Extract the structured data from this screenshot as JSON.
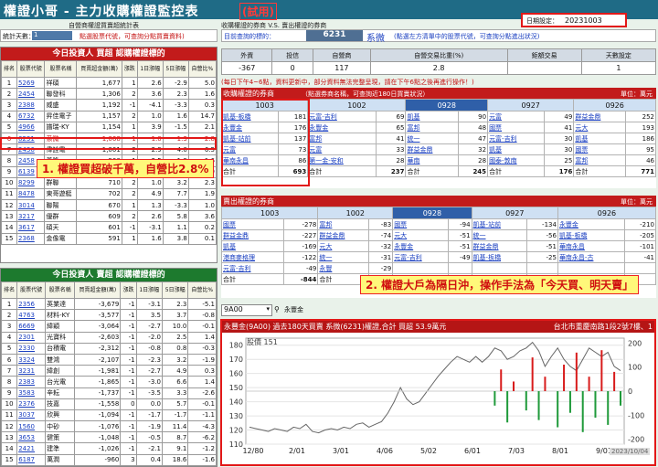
{
  "title_bar": {
    "title": "權證小哥 - 主力收購權證監控表",
    "badge": "(試用)"
  },
  "left_header": {
    "subtitle": "自營商權證買賣超統計表",
    "days_label": "統計天數：",
    "days_value": "1",
    "hint": "點選股票代號，可查詢分點買賣資料)"
  },
  "mid_header": {
    "subtitle": "收購權證的券商 V.S. 賣出權證的券商",
    "query_label": "目前查詢的標的：",
    "stock_code": "6231",
    "stock_name": "系微",
    "query_hint": "(點選左方清單中的股票代號，可查詢分點進出狀況)",
    "date_label": "日期設定：",
    "date_value": "20231003"
  },
  "summary": {
    "headers": [
      "外資",
      "投信",
      "自營商",
      "自營交易比重(%)",
      "鉅額交易",
      "天數設定"
    ],
    "values": [
      "-367",
      "0",
      "117",
      "2.8",
      "",
      "1"
    ]
  },
  "notice": "(每日下午4~6點，資料更新中，部分資料無法完整呈現，請在下午6點之後再進行操作！)",
  "buy_panel": {
    "title": "今日投資人 買超 認購權證標的",
    "columns": [
      "排名",
      "股票代號",
      "股票名稱",
      "買賣超金額(萬)",
      "漲跌",
      "1日漲幅",
      "5日漲幅",
      "自營比%"
    ],
    "rows": [
      [
        "1",
        "5269",
        "祥碩",
        "1,677",
        "1",
        "2.6",
        "-2.9",
        "5.0"
      ],
      [
        "2",
        "2454",
        "聯發科",
        "1,306",
        "2",
        "3.6",
        "2.3",
        "1.6"
      ],
      [
        "3",
        "2388",
        "威盛",
        "1,192",
        "-1",
        "-4.1",
        "-3.3",
        "0.3"
      ],
      [
        "4",
        "6732",
        "昇佳電子",
        "1,157",
        "2",
        "1.0",
        "1.6",
        "14.7"
      ],
      [
        "5",
        "4966",
        "譜瑞-KY",
        "1,154",
        "1",
        "3.9",
        "-1.5",
        "2.1"
      ],
      [
        "6",
        "6231",
        "系微",
        "1,068",
        "-1",
        "-1.0",
        "-1.3",
        "2.8"
      ],
      [
        "7",
        "2436",
        "偉詮電",
        "1,001",
        "2",
        "2.9",
        "4.0",
        "6.5"
      ],
      [
        "8",
        "2458",
        "義隆",
        "900",
        "1",
        "2.5",
        "1.9",
        "1.6"
      ],
      [
        "9",
        "6139",
        "亞翔",
        "755",
        "0",
        "0.0",
        "12.8",
        "0.9"
      ],
      [
        "10",
        "8299",
        "群聯",
        "710",
        "2",
        "1.0",
        "3.2",
        "2.3"
      ],
      [
        "11",
        "8478",
        "東哥遊艇",
        "702",
        "2",
        "4.9",
        "7.7",
        "1.9"
      ],
      [
        "12",
        "3014",
        "聯陽",
        "670",
        "1",
        "1.3",
        "-3.3",
        "1.0"
      ],
      [
        "13",
        "3217",
        "優群",
        "609",
        "2",
        "2.6",
        "5.8",
        "3.6"
      ],
      [
        "14",
        "3617",
        "碩天",
        "601",
        "-1",
        "-3.1",
        "1.1",
        "0.2"
      ],
      [
        "15",
        "2368",
        "金像電",
        "591",
        "1",
        "1.6",
        "3.8",
        "0.1"
      ]
    ]
  },
  "sell_panel": {
    "title": "今日投資人 賣超 認購權證標的",
    "columns": [
      "排名",
      "股票代號",
      "股票名稱",
      "買賣超金額(萬)",
      "漲跌",
      "1日漲幅",
      "5日漲幅",
      "自營比%"
    ],
    "rows": [
      [
        "1",
        "2356",
        "英業達",
        "-3,679",
        "-1",
        "-3.1",
        "2.3",
        "-5.1"
      ],
      [
        "2",
        "4763",
        "材料-KY",
        "-3,577",
        "-1",
        "3.5",
        "3.7",
        "-0.8"
      ],
      [
        "3",
        "6669",
        "緯穎",
        "-3,064",
        "-1",
        "-2.7",
        "10.0",
        "-0.1"
      ],
      [
        "4",
        "2301",
        "光寶科",
        "-2,603",
        "-1",
        "-2.0",
        "2.5",
        "1.4"
      ],
      [
        "5",
        "2330",
        "台積電",
        "-2,312",
        "-1",
        "-0.8",
        "0.8",
        "-0.3"
      ],
      [
        "6",
        "3324",
        "雙鴻",
        "-2,107",
        "-1",
        "-2.3",
        "3.2",
        "-1.9"
      ],
      [
        "7",
        "3231",
        "緯創",
        "-1,981",
        "-1",
        "-2.7",
        "4.9",
        "0.3"
      ],
      [
        "8",
        "2383",
        "台光電",
        "-1,865",
        "-1",
        "-3.0",
        "6.6",
        "1.4"
      ],
      [
        "9",
        "3583",
        "辛耘",
        "-1,737",
        "-1",
        "-3.5",
        "3.3",
        "-2.6"
      ],
      [
        "10",
        "2376",
        "技嘉",
        "-1,558",
        "0",
        "0.0",
        "5.7",
        "-0.1"
      ],
      [
        "11",
        "3037",
        "欣興",
        "-1,094",
        "-1",
        "-1.7",
        "-1.7",
        "-1.1"
      ],
      [
        "12",
        "1560",
        "中砂",
        "-1,076",
        "-1",
        "-1.9",
        "11.4",
        "-4.3"
      ],
      [
        "13",
        "3653",
        "健策",
        "-1,048",
        "-1",
        "-0.5",
        "8.7",
        "-6.2"
      ],
      [
        "14",
        "2421",
        "建準",
        "-1,026",
        "-1",
        "-2.1",
        "9.1",
        "-1.2"
      ],
      [
        "15",
        "6187",
        "萬潤",
        "-960",
        "3",
        "0.4",
        "18.6",
        "-1.6"
      ]
    ]
  },
  "buy_brokers": {
    "title": "收購權證的券商",
    "hint": "（點選券商名稱，可查詢近180日買賣狀況）",
    "unit": "單位：萬元",
    "dates": [
      "1003",
      "1002",
      "0928",
      "0927",
      "0926"
    ],
    "cols": [
      [
        [
          "凱基-板橋",
          "181"
        ],
        [
          "永豐金",
          "176"
        ],
        [
          "凱基-站前",
          "137"
        ],
        [
          "元富",
          "73"
        ],
        [
          "華南永昌",
          "86"
        ]
      ],
      [
        [
          "元富-吉利",
          "69"
        ],
        [
          "永豐金",
          "65"
        ],
        [
          "富邦",
          "41"
        ],
        [
          "元富",
          "33"
        ],
        [
          "第一金-安和",
          "28"
        ]
      ],
      [
        [
          "凱基",
          "90"
        ],
        [
          "富邦",
          "48"
        ],
        [
          "統一",
          "47"
        ],
        [
          "群益金鼎",
          "32"
        ],
        [
          "華南",
          "28"
        ]
      ],
      [
        [
          "元富",
          "49"
        ],
        [
          "國票",
          "41"
        ],
        [
          "元富-吉利",
          "30"
        ],
        [
          "凱基",
          "30"
        ],
        [
          "國泰-敦南",
          "25"
        ]
      ],
      [
        [
          "群益金鼎",
          "252"
        ],
        [
          "元大",
          "193"
        ],
        [
          "凱基",
          "186"
        ],
        [
          "國票",
          "95"
        ],
        [
          "富邦",
          "46"
        ]
      ]
    ],
    "totals": [
      "693",
      "237",
      "245",
      "176",
      "771"
    ],
    "total_label": "合計"
  },
  "sell_brokers": {
    "title": "賣出權證的券商",
    "unit": "單位：萬元",
    "dates": [
      "1003",
      "1002",
      "0928",
      "0927",
      "0926"
    ],
    "cols": [
      [
        [
          "國票",
          "-278"
        ],
        [
          "群益金鼎",
          "-227"
        ],
        [
          "凱基",
          "-169"
        ],
        [
          "港商麥格理",
          "-122"
        ],
        [
          "元富-吉利",
          "-49"
        ]
      ],
      [
        [
          "富邦",
          "-83"
        ],
        [
          "群益金鼎",
          "-74"
        ],
        [
          "元大",
          "-32"
        ],
        [
          "統一",
          "-31"
        ],
        [
          "永豐",
          "-29"
        ]
      ],
      [
        [
          "國票",
          "-94"
        ],
        [
          "元大",
          "-51"
        ],
        [
          "永豐金",
          "-51"
        ],
        [
          "元富-吉利",
          "-49"
        ],
        [
          "",
          ""
        ]
      ],
      [
        [
          "凱基-站前",
          "-134"
        ],
        [
          "統一",
          "-56"
        ],
        [
          "群益金鼎",
          "-51"
        ],
        [
          "凱基-板橋",
          "-25"
        ],
        [
          "",
          ""
        ]
      ],
      [
        [
          "永豐金",
          "-210"
        ],
        [
          "凱基-板橋",
          "-205"
        ],
        [
          "華南永昌",
          "-101"
        ],
        [
          "華南永昌-古",
          "-41"
        ],
        [
          "",
          ""
        ]
      ]
    ],
    "totals": [
      "-844",
      "",
      "",
      "",
      ""
    ],
    "total_label": "合計"
  },
  "callouts": {
    "c1": "1. 權證買超破千萬，自營比2.8%",
    "c2": "2. 權證大戶為隔日沖，操作手法為「今天買、明天賣」"
  },
  "broker_selector": {
    "value": "9A00",
    "name": "永豐金"
  },
  "chart": {
    "title": "永豐金(9A00) 過去180天買賣 系微(6231)權證,合計  買超 53.9萬元",
    "address": "台北市重慶南路1段2號7樓、1",
    "price_label": "股價 151",
    "date_badge": "2023/10/04"
  },
  "chart_data": {
    "type": "line",
    "title": "永豐金(9A00) 過去180天買賣 系微(6231)權證,合計  買超 53.9萬元",
    "x_ticks": [
      "12/80",
      "2/01",
      "3/01",
      "4/06",
      "5/02",
      "6/01",
      "7/03",
      "8/01",
      "9/01"
    ],
    "y_left": {
      "ticks": [
        "180",
        "170",
        "160",
        "150",
        "140",
        "130",
        "120",
        "110"
      ],
      "ylim": [
        110,
        185
      ]
    },
    "y_right": {
      "ticks": [
        "200",
        "100",
        "0",
        "-100",
        "-200"
      ],
      "ylim": [
        -220,
        220
      ]
    },
    "price": [
      122,
      121,
      120,
      119,
      121,
      120,
      119,
      122,
      121,
      124,
      119,
      118,
      120,
      121,
      120,
      122,
      121,
      124,
      125,
      122,
      124,
      126,
      132,
      140,
      150,
      142,
      138,
      140,
      146,
      152,
      158,
      163,
      168,
      172,
      170,
      168,
      172,
      168,
      172,
      178,
      176,
      170,
      172,
      176,
      178,
      182,
      176,
      165,
      172,
      178,
      170,
      165,
      162,
      170,
      178,
      175,
      172,
      175,
      165,
      162
    ],
    "trades": [
      {
        "i": 39,
        "v": -60
      },
      {
        "i": 40,
        "v": 90
      },
      {
        "i": 41,
        "v": -130
      },
      {
        "i": 42,
        "v": 40
      },
      {
        "i": 44,
        "v": -80
      },
      {
        "i": 45,
        "v": 140
      },
      {
        "i": 46,
        "v": -120
      },
      {
        "i": 47,
        "v": 60
      },
      {
        "i": 49,
        "v": -150
      },
      {
        "i": 50,
        "v": 110
      },
      {
        "i": 51,
        "v": -90
      },
      {
        "i": 52,
        "v": 160
      },
      {
        "i": 53,
        "v": -170
      },
      {
        "i": 54,
        "v": 60
      },
      {
        "i": 55,
        "v": -110
      },
      {
        "i": 56,
        "v": 170
      },
      {
        "i": 57,
        "v": -140
      },
      {
        "i": 58,
        "v": 80
      },
      {
        "i": 59,
        "v": -60
      }
    ]
  }
}
